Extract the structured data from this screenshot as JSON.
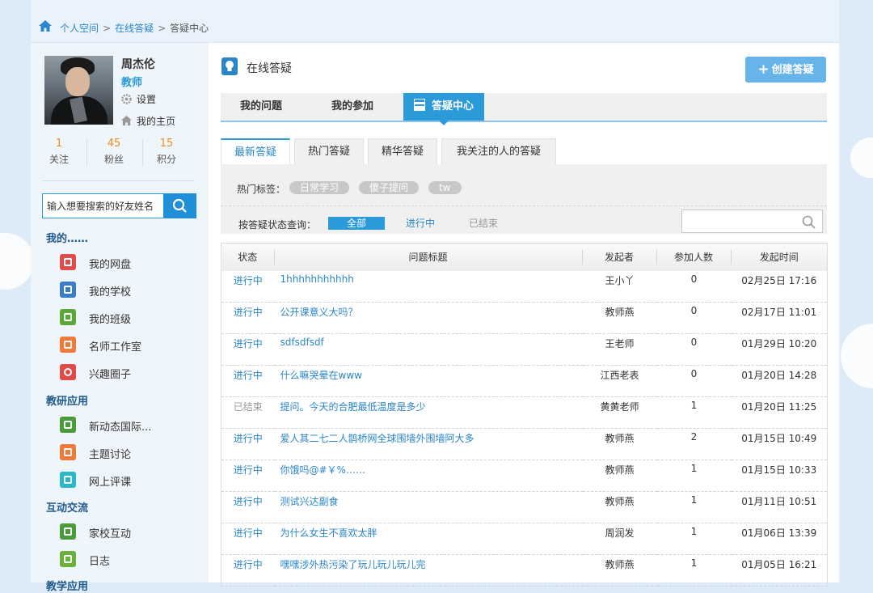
{
  "breadcrumb": {
    "items": [
      "个人空间",
      "在线答疑",
      "答疑中心"
    ],
    "sep": ">"
  },
  "user": {
    "name": "周杰伦",
    "role": "教师",
    "settings": "设置",
    "homepage": "我的主页",
    "stats": [
      {
        "value": "1",
        "label": "关注"
      },
      {
        "value": "45",
        "label": "粉丝"
      },
      {
        "value": "15",
        "label": "积分"
      }
    ]
  },
  "friend_search": {
    "placeholder": "输入想要搜索的好友姓名"
  },
  "sidebar": {
    "sections": [
      {
        "title": "我的……",
        "items": [
          {
            "label": "我的网盘",
            "color": "#e04c4c"
          },
          {
            "label": "我的学校",
            "color": "#3a7cc6"
          },
          {
            "label": "我的班级",
            "color": "#5ba83a"
          },
          {
            "label": "名师工作室",
            "color": "#f07a3a"
          },
          {
            "label": "兴趣圈子",
            "color": "#e04c4c"
          }
        ]
      },
      {
        "title": "教研应用",
        "items": [
          {
            "label": "新动态国际...",
            "color": "#4a9c3a"
          },
          {
            "label": "主题讨论",
            "color": "#f07a3a"
          },
          {
            "label": "网上评课",
            "color": "#2ab8c8"
          }
        ]
      },
      {
        "title": "互动交流",
        "items": [
          {
            "label": "家校互动",
            "color": "#4a9c3a"
          },
          {
            "label": "日志",
            "color": "#6ab03a"
          }
        ]
      },
      {
        "title": "教学应用"
      }
    ]
  },
  "main": {
    "title": "在线答疑",
    "create_label": "创建答疑",
    "tabs": [
      "我的问题",
      "我的参加",
      "答疑中心"
    ],
    "subtabs": [
      "最新答疑",
      "热门答疑",
      "精华答疑",
      "我关注的人的答疑"
    ],
    "hot_tags_label": "热门标签：",
    "hot_tags": [
      "日常学习",
      "傻子提问",
      "tw"
    ],
    "status_filter_label": "按答疑状态查询：",
    "status_options": [
      "全部",
      "进行中",
      "已结束"
    ],
    "search_value": ""
  },
  "table": {
    "columns": [
      "状态",
      "问题标题",
      "发起者",
      "参加人数",
      "发起时间"
    ],
    "rows": [
      {
        "status": "进行中",
        "title": "1hhhhhhhhhhh",
        "author": "王小丫",
        "count": "0",
        "time": "02月25日 17:16"
      },
      {
        "status": "进行中",
        "title": "公开课意义大吗？",
        "author": "教师燕",
        "count": "0",
        "time": "02月17日 11:01"
      },
      {
        "status": "进行中",
        "title": "sdfsdfsdf",
        "author": "王老师",
        "count": "0",
        "time": "01月29日 10:20"
      },
      {
        "status": "进行中",
        "title": "什么嘛哭晕在www",
        "author": "江西老表",
        "count": "0",
        "time": "01月20日 14:28"
      },
      {
        "status": "已结束",
        "title": "提问。今天的合肥最低温度是多少",
        "author": "黄黄老师",
        "count": "1",
        "time": "01月20日 11:25"
      },
      {
        "status": "进行中",
        "title": "爱人其二七二人鹊桥网全球围墙外围墙阿大多",
        "author": "教师燕",
        "count": "2",
        "time": "01月15日 10:49"
      },
      {
        "status": "进行中",
        "title": "你饿吗@#￥%……",
        "author": "教师燕",
        "count": "1",
        "time": "01月15日 10:33"
      },
      {
        "status": "进行中",
        "title": "测试兴达副食",
        "author": "教师燕",
        "count": "1",
        "time": "01月11日 10:51"
      },
      {
        "status": "进行中",
        "title": "为什么女生不喜欢太胖",
        "author": "周润发",
        "count": "1",
        "time": "01月06日 13:39"
      },
      {
        "status": "进行中",
        "title": "嘿嘿涉外热污染了玩儿玩儿玩儿完",
        "author": "教师燕",
        "count": "1",
        "time": "01月05日 16:21"
      }
    ]
  },
  "colors": {
    "accent": "#2a9ad8",
    "link": "#2a86c8",
    "stat": "#f08c1e",
    "ended": "#999999"
  }
}
